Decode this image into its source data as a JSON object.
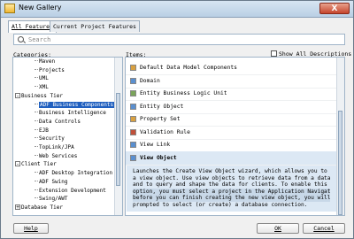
{
  "window": {
    "title": "New Gallery",
    "close_symbol": "X"
  },
  "tabs": [
    {
      "label": "All Features",
      "active": true
    },
    {
      "label": "Current Project Features",
      "active": false
    }
  ],
  "search": {
    "placeholder": "Search"
  },
  "categories": {
    "label": "Categories:",
    "nodes": [
      {
        "label": "Maven",
        "depth": 2
      },
      {
        "label": "Projects",
        "depth": 2
      },
      {
        "label": "UML",
        "depth": 2
      },
      {
        "label": "XML",
        "depth": 2
      },
      {
        "label": "Business Tier",
        "depth": 1,
        "expander": "-"
      },
      {
        "label": "ADF Business Components",
        "depth": 2,
        "selected": true
      },
      {
        "label": "Business Intelligence",
        "depth": 2
      },
      {
        "label": "Data Controls",
        "depth": 2
      },
      {
        "label": "EJB",
        "depth": 2
      },
      {
        "label": "Security",
        "depth": 2
      },
      {
        "label": "TopLink/JPA",
        "depth": 2
      },
      {
        "label": "Web Services",
        "depth": 2
      },
      {
        "label": "Client Tier",
        "depth": 1,
        "expander": "-"
      },
      {
        "label": "ADF Desktop Integration",
        "depth": 2
      },
      {
        "label": "ADF Swing",
        "depth": 2
      },
      {
        "label": "Extension Development",
        "depth": 2
      },
      {
        "label": "Swing/AWT",
        "depth": 2
      },
      {
        "label": "Database Tier",
        "depth": 1,
        "expander": "+"
      }
    ]
  },
  "items": {
    "label": "Items:",
    "show_all_label": "Show All Descriptions",
    "list": [
      {
        "label": "Default Data Model Components",
        "icon_color": "#d8a040"
      },
      {
        "label": "Domain",
        "icon_color": "#5a8fcf"
      },
      {
        "label": "Entity Business Logic Unit",
        "icon_color": "#7aa45a"
      },
      {
        "label": "Entity Object",
        "icon_color": "#5a8fcf"
      },
      {
        "label": "Property Set",
        "icon_color": "#d8a040"
      },
      {
        "label": "Validation Rule",
        "icon_color": "#c0503a"
      },
      {
        "label": "View Link",
        "icon_color": "#5a8fcf"
      },
      {
        "label": "View Object",
        "icon_color": "#5a8fcf",
        "selected": true
      }
    ],
    "description": [
      "Launches the Create View Object wizard, which allows you to create",
      "a view object. Use view objects to retrieve data from a data source",
      "and to query and shape the data for clients. To enable this",
      "option, you must select a project in the Application Navigator",
      "before you can finish creating the new view object, you will be",
      "prompted to select (or create) a database connection."
    ]
  },
  "buttons": {
    "help": "Help",
    "ok": "OK",
    "cancel": "Cancel"
  }
}
